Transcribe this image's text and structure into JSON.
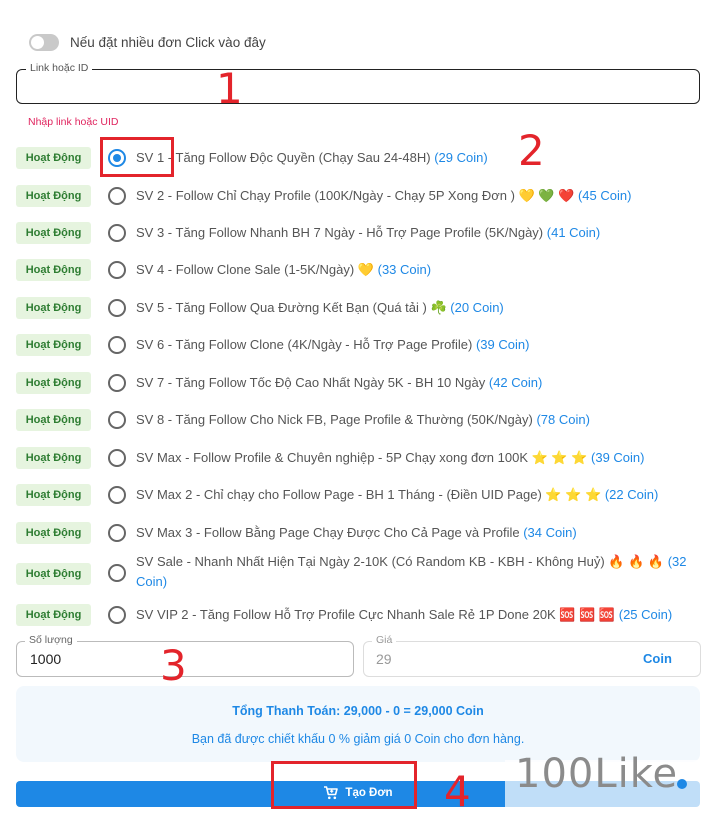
{
  "toggle": {
    "label": "Nếu đặt nhiều đơn Click vào đây",
    "on": false
  },
  "link": {
    "legend": "Link hoặc ID",
    "value": "",
    "hint": "Nhập link hoặc UID"
  },
  "services": [
    {
      "status": "Hoạt Động",
      "name": "SV 1 - Tăng Follow Độc Quyền (Chạy Sau 24-48H)",
      "price": "(29 Coin)",
      "selected": true
    },
    {
      "status": "Hoạt Động",
      "name": "SV 2 - Follow Chỉ Chạy Profile (100K/Ngày - Chạy 5P Xong Đơn ) 💛 💚 ❤️",
      "price": "(45 Coin)",
      "selected": false
    },
    {
      "status": "Hoạt Động",
      "name": "SV 3 - Tăng Follow Nhanh BH 7 Ngày - Hỗ Trợ Page Profile (5K/Ngày)",
      "price": "(41 Coin)",
      "selected": false
    },
    {
      "status": "Hoạt Động",
      "name": "SV 4 - Follow Clone Sale (1-5K/Ngày) 💛",
      "price": "(33 Coin)",
      "selected": false
    },
    {
      "status": "Hoạt Động",
      "name": "SV 5 - Tăng Follow Qua Đường Kết Bạn (Quá tải ) ☘️",
      "price": "(20 Coin)",
      "selected": false
    },
    {
      "status": "Hoạt Động",
      "name": "SV 6 - Tăng Follow Clone (4K/Ngày - Hỗ Trợ Page Profile)",
      "price": "(39 Coin)",
      "selected": false
    },
    {
      "status": "Hoạt Động",
      "name": "SV 7 - Tăng Follow Tốc Độ Cao Nhất Ngày 5K - BH 10 Ngày",
      "price": "(42 Coin)",
      "selected": false
    },
    {
      "status": "Hoạt Động",
      "name": "SV 8 - Tăng Follow Cho Nick FB, Page Profile & Thường (50K/Ngày)",
      "price": "(78 Coin)",
      "selected": false
    },
    {
      "status": "Hoạt Động",
      "name": "SV Max - Follow Profile & Chuyên nghiệp - 5P Chạy xong đơn 100K ⭐ ⭐ ⭐",
      "price": "(39 Coin)",
      "selected": false
    },
    {
      "status": "Hoạt Động",
      "name": "SV Max 2 - Chỉ chạy cho Follow Page - BH 1 Tháng - (Điền UID Page) ⭐ ⭐ ⭐",
      "price": "(22 Coin)",
      "selected": false
    },
    {
      "status": "Hoạt Động",
      "name": "SV Max 3 - Follow Bằng Page Chạy Được Cho Cả Page và Profile",
      "price": "(34 Coin)",
      "selected": false
    },
    {
      "status": "Hoạt Động",
      "name": "SV Sale - Nhanh Nhất Hiện Tại Ngày 2-10K (Có Random KB - KBH - Không Huỷ) 🔥 🔥 🔥",
      "price": "(32 Coin)",
      "selected": false
    },
    {
      "status": "Hoạt Động",
      "name": "SV VIP 2 - Tăng Follow Hỗ Trợ Profile Cực Nhanh Sale Rẻ 1P Done 20K 🆘 🆘 🆘",
      "price": "(25 Coin)",
      "selected": false
    }
  ],
  "quantity": {
    "legend": "Số lượng",
    "value": "1000"
  },
  "price": {
    "legend": "Giá",
    "value": "29",
    "unit": "Coin"
  },
  "summary": {
    "total": "Tổng Thanh Toán: 29,000 - 0 = 29,000 Coin",
    "discount": "Bạn đã được chiết khấu 0 % giảm giá 0 Coin cho đơn hàng."
  },
  "order_button": {
    "label": "Tạo Đơn",
    "icon": "cart-icon"
  },
  "watermark": {
    "text": "100Like"
  },
  "annotations": {
    "a1": "1",
    "a2": "2",
    "a3": "3",
    "a4": "4",
    "color": "#e3242b"
  },
  "colors": {
    "accent": "#1e88e5",
    "badge_bg": "#e6f4df",
    "badge_text": "#2e7d32",
    "hint": "#e0245e"
  }
}
